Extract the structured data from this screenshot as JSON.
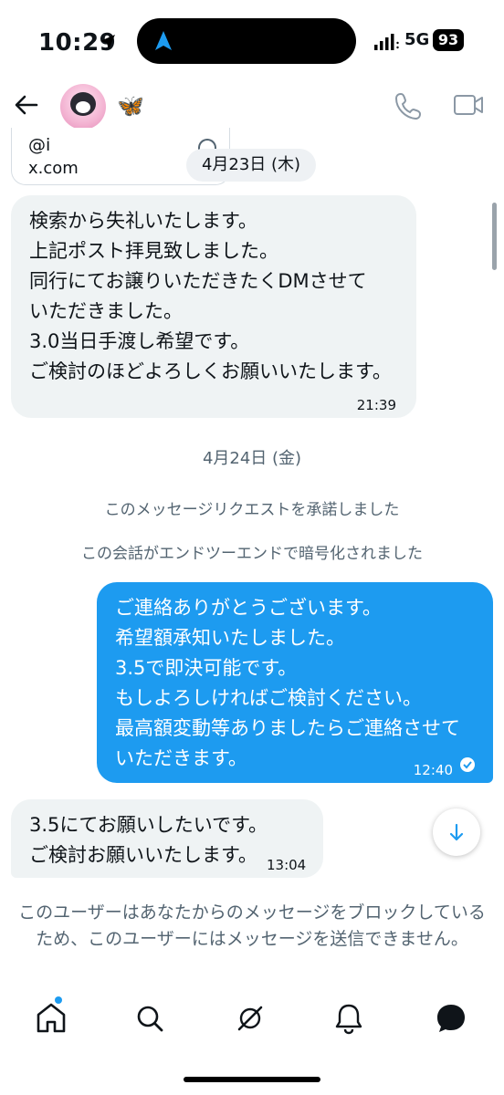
{
  "status_bar": {
    "time": "10:29",
    "network": "5G",
    "battery": "93"
  },
  "header": {
    "emoji": "🦋"
  },
  "quote": {
    "handle": "@i",
    "domain": "x.com"
  },
  "messages": {
    "date1": "4月23日 (木)",
    "msg1": {
      "lines": [
        "検索から失礼いたします。",
        "上記ポスト拝見致しました。",
        "同行にてお譲りいただきたくDMさせて",
        "いただきました。",
        "3.0当日手渡し希望です。",
        "ご検討のほどよろしくお願いいたします。"
      ],
      "time": "21:39"
    },
    "date2": "4月24日 (金)",
    "system1": "このメッセージリクエストを承諾しました",
    "system2": "この会話がエンドツーエンドで暗号化されました",
    "msg2": {
      "lines": [
        "ご連絡ありがとうございます。",
        "希望額承知いたしました。",
        "3.5で即決可能です。",
        "もしよろしければご検討ください。",
        "最高額変動等ありましたらご連絡させて",
        "いただきます。"
      ],
      "time": "12:40"
    },
    "msg3": {
      "lines": [
        "3.5にてお願いしたいです。",
        "ご検討お願いいたします。"
      ],
      "time": "13:04"
    }
  },
  "blocked_notice": "このユーザーはあなたからのメッセージをブロックしているため、このユーザーにはメッセージを送信できません。",
  "colors": {
    "accent": "#1d9bf0",
    "incoming_bubble": "#eff3f4",
    "secondary_text": "#536471"
  },
  "icons": {
    "header": [
      "back-arrow-icon",
      "phone-icon",
      "video-camera-icon"
    ],
    "bottom_nav": [
      "home-icon",
      "search-icon",
      "grok-icon",
      "bell-icon",
      "messages-icon"
    ]
  }
}
